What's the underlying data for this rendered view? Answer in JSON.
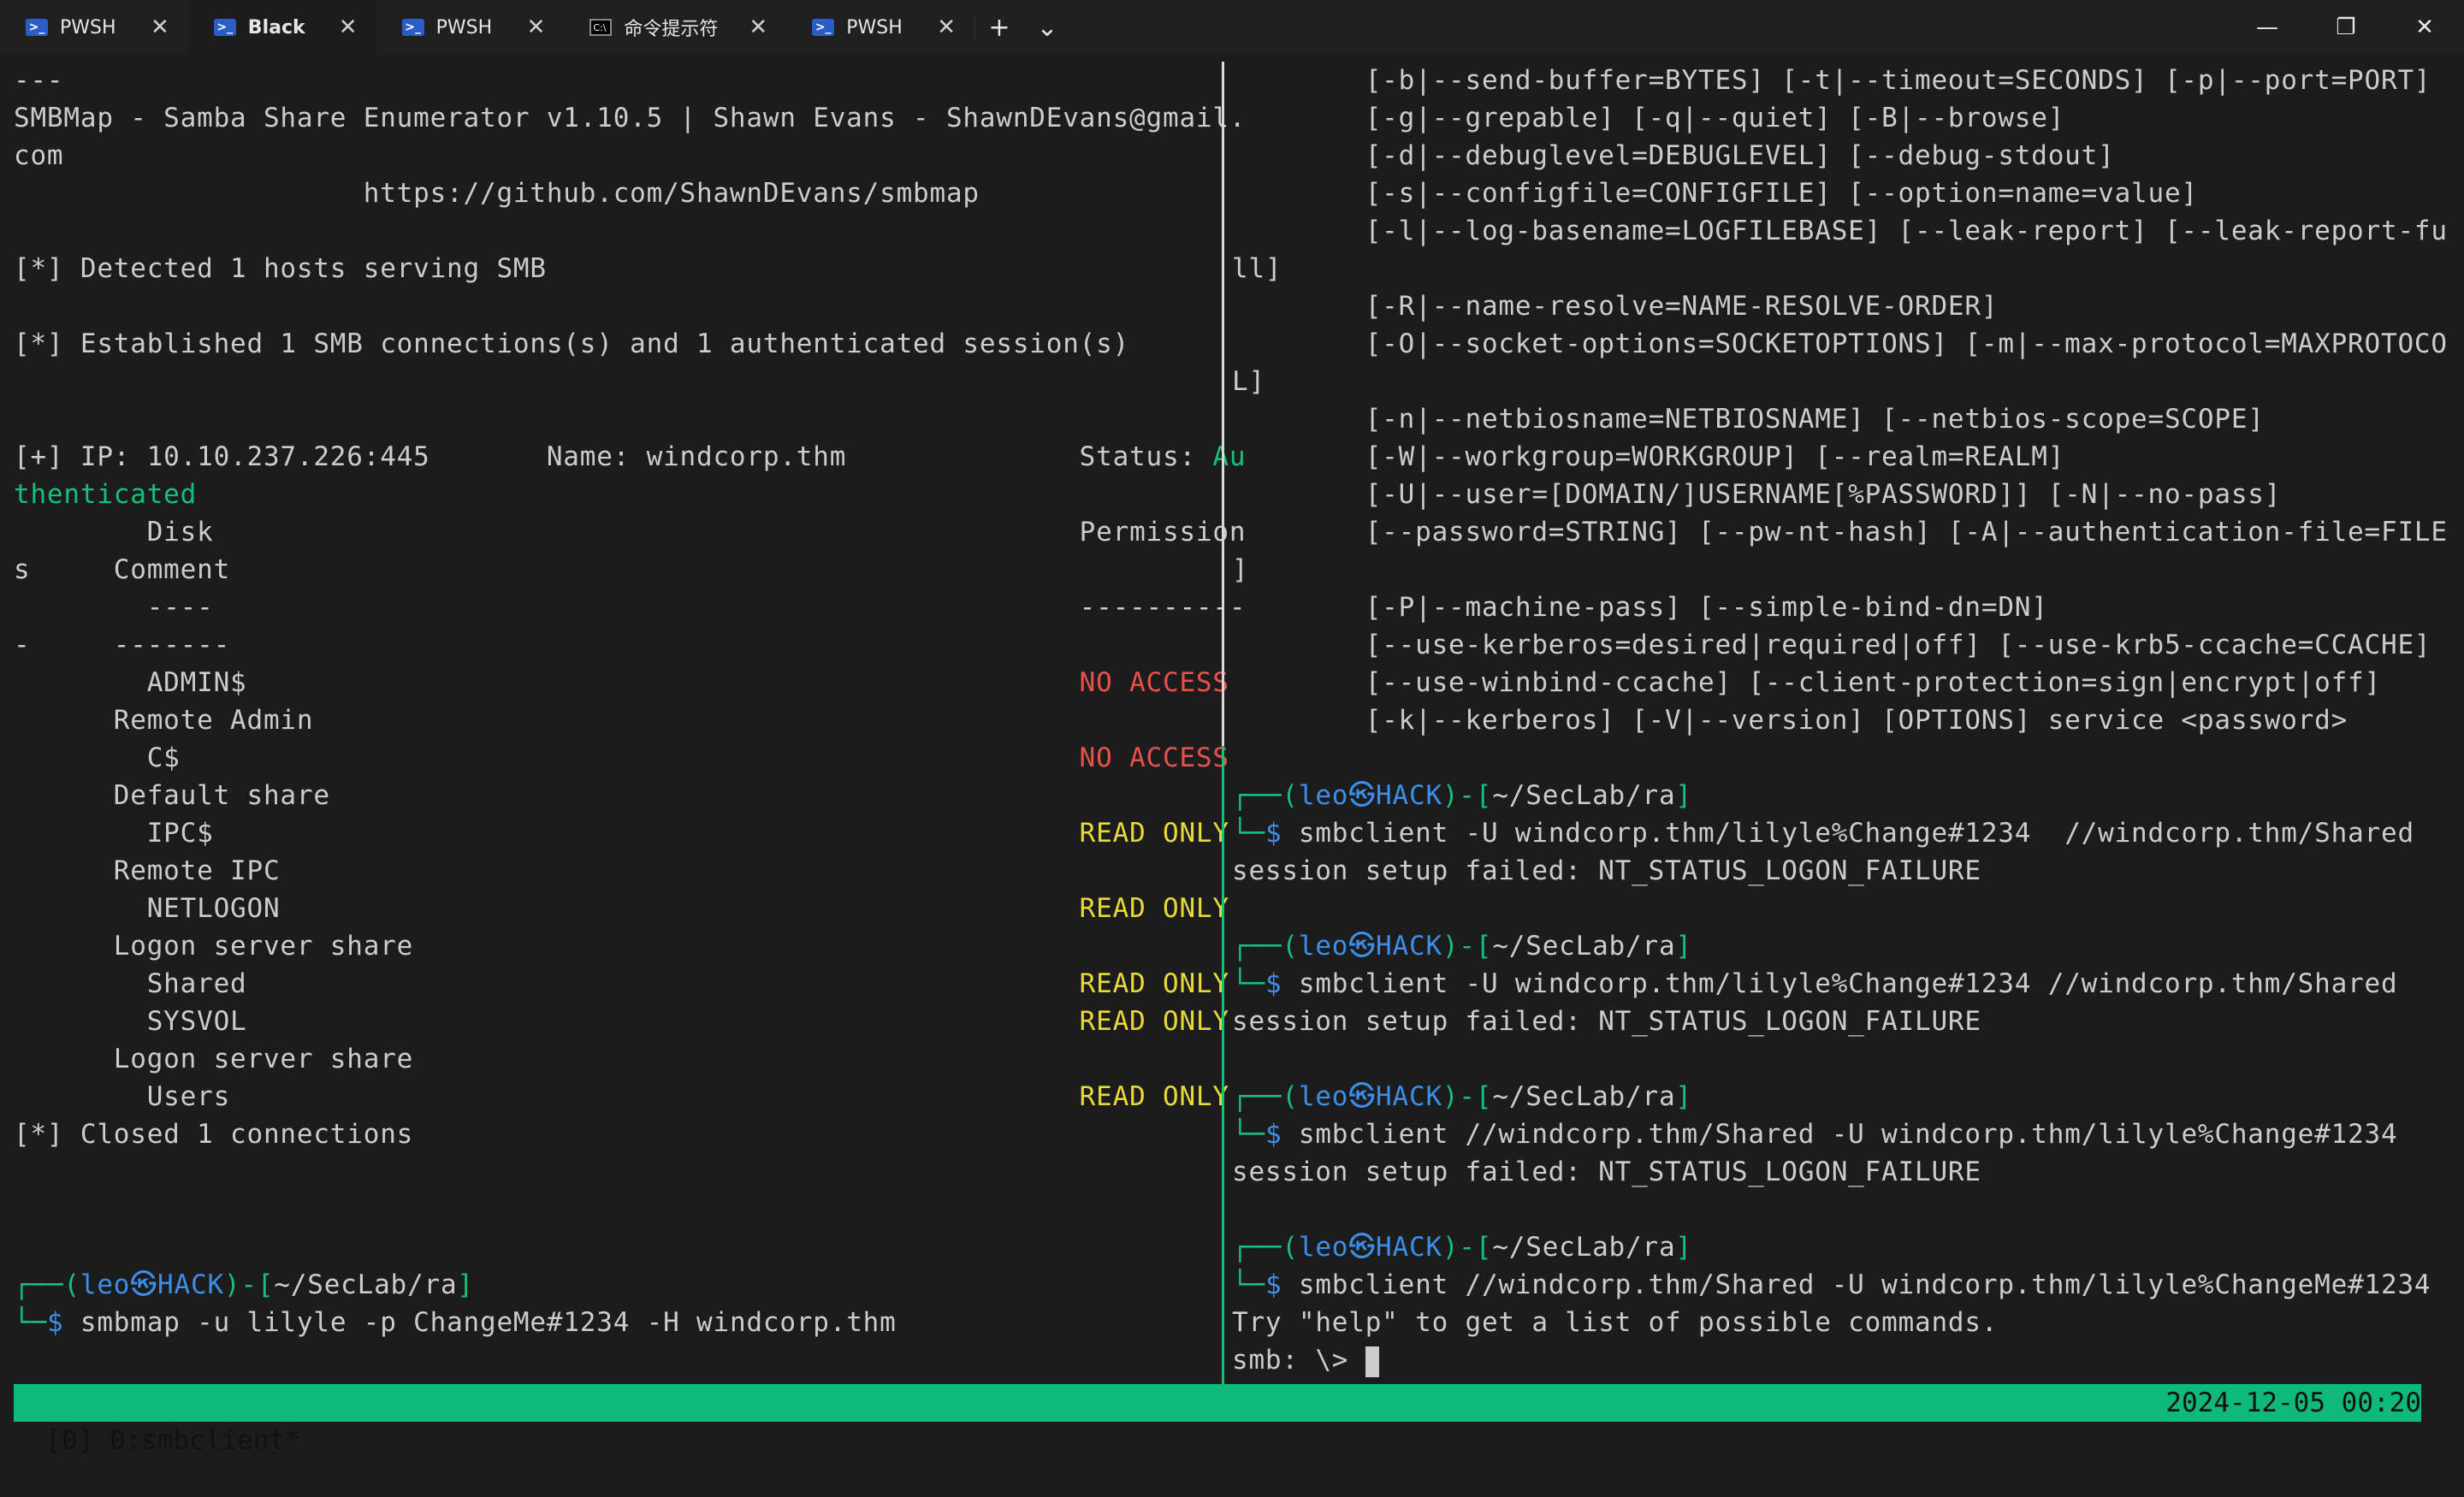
{
  "tabs": [
    {
      "label": "PWSH",
      "icon": "powershell-icon"
    },
    {
      "label": "Black",
      "icon": "powershell-icon"
    },
    {
      "label": "PWSH",
      "icon": "powershell-icon"
    },
    {
      "label": "命令提示符",
      "icon": "cmd-icon"
    },
    {
      "label": "PWSH",
      "icon": "powershell-icon"
    }
  ],
  "tab_close_glyph": "✕",
  "new_tab_glyph": "+",
  "dropdown_glyph": "⌄",
  "window": {
    "minimize": "—",
    "maximize": "❐",
    "close": "✕"
  },
  "left": {
    "l1": "---",
    "l2": "SMBMap - Samba Share Enumerator v1.10.5 | Shawn Evans - ShawnDEvans@gmail.",
    "l3": "com",
    "l4": "                     https://github.com/ShawnDEvans/smbmap",
    "l5": "",
    "l6": "[*] Detected 1 hosts serving SMB",
    "l7": "",
    "l8": "[*] Established 1 SMB connections(s) and 1 authenticated session(s)",
    "l9": "",
    "l10": "",
    "l11a": "[+] IP: 10.10.237.226:445       Name: windcorp.thm              Status: ",
    "l11b": "Au",
    "l12": "thenticated",
    "l13a": "        Disk                                                    ",
    "l13b": "Permission",
    "l14": "s     Comment",
    "l15a": "        ----                                                    ",
    "l15b": "----------",
    "l16": "-     -------",
    "l17a": "        ADMIN$                                                  ",
    "l17b": "NO ACCESS",
    "l18": "      Remote Admin",
    "l19a": "        C$                                                      ",
    "l19b": "NO ACCESS",
    "l20": "      Default share",
    "l21a": "        IPC$                                                    ",
    "l21b": "READ ONLY",
    "l22": "      Remote IPC",
    "l23a": "        NETLOGON                                                ",
    "l23b": "READ ONLY",
    "l24": "      Logon server share",
    "l25a": "        Shared                                                  ",
    "l25b": "READ ONLY",
    "l26a": "        SYSVOL                                                  ",
    "l26b": "READ ONLY",
    "l27": "      Logon server share",
    "l28a": "        Users                                                   ",
    "l28b": "READ ONLY",
    "l29": "[*] Closed 1 connections",
    "prompt_top_a": "┌──(",
    "prompt_user": "leo㉿HACK",
    "prompt_top_b": ")-[",
    "prompt_path": "~/SecLab/ra",
    "prompt_top_c": "]",
    "prompt_bot_a": "└─",
    "prompt_dollar": "$",
    "cmd": " smbmap -u lilyle -p ChangeMe#1234 -H windcorp.thm"
  },
  "right": {
    "r1": "        [-b|--send-buffer=BYTES] [-t|--timeout=SECONDS] [-p|--port=PORT]",
    "r2": "        [-g|--grepable] [-q|--quiet] [-B|--browse]",
    "r3": "        [-d|--debuglevel=DEBUGLEVEL] [--debug-stdout]",
    "r4": "        [-s|--configfile=CONFIGFILE] [--option=name=value]",
    "r5": "        [-l|--log-basename=LOGFILEBASE] [--leak-report] [--leak-report-fu",
    "r6": "ll]",
    "r7": "        [-R|--name-resolve=NAME-RESOLVE-ORDER]",
    "r8": "        [-O|--socket-options=SOCKETOPTIONS] [-m|--max-protocol=MAXPROTOCO",
    "r9": "L]",
    "r10": "        [-n|--netbiosname=NETBIOSNAME] [--netbios-scope=SCOPE]",
    "r11": "        [-W|--workgroup=WORKGROUP] [--realm=REALM]",
    "r12": "        [-U|--user=[DOMAIN/]USERNAME[%PASSWORD]] [-N|--no-pass]",
    "r13": "        [--password=STRING] [--pw-nt-hash] [-A|--authentication-file=FILE",
    "r14": "]",
    "r15": "        [-P|--machine-pass] [--simple-bind-dn=DN]",
    "r16": "        [--use-kerberos=desired|required|off] [--use-krb5-ccache=CCACHE]",
    "r17": "        [--use-winbind-ccache] [--client-protection=sign|encrypt|off]",
    "r18": "        [-k|--kerberos] [-V|--version] [OPTIONS] service <password>",
    "cmd1": " smbclient -U windcorp.thm/lilyle%Change#1234  //windcorp.thm/Shared",
    "out1": "session setup failed: NT_STATUS_LOGON_FAILURE",
    "cmd2": " smbclient -U windcorp.thm/lilyle%Change#1234 //windcorp.thm/Shared",
    "out2": "session setup failed: NT_STATUS_LOGON_FAILURE",
    "cmd3": " smbclient //windcorp.thm/Shared -U windcorp.thm/lilyle%Change#1234",
    "out3": "session setup failed: NT_STATUS_LOGON_FAILURE",
    "cmd4": " smbclient //windcorp.thm/Shared -U windcorp.thm/lilyle%ChangeMe#1234",
    "out4": "Try \"help\" to get a list of possible commands.",
    "smb_prompt": "smb: \\> "
  },
  "statusbar": {
    "left": "[0] 0:smbclient*",
    "right": "2024-12-05 00:20"
  },
  "colors": {
    "status_bg": "#0fb97a",
    "prompt_green": "#16c07a",
    "host_blue": "#3b8eea",
    "no_access_red": "#e8514a",
    "read_only_yellow": "#e8d83a"
  }
}
